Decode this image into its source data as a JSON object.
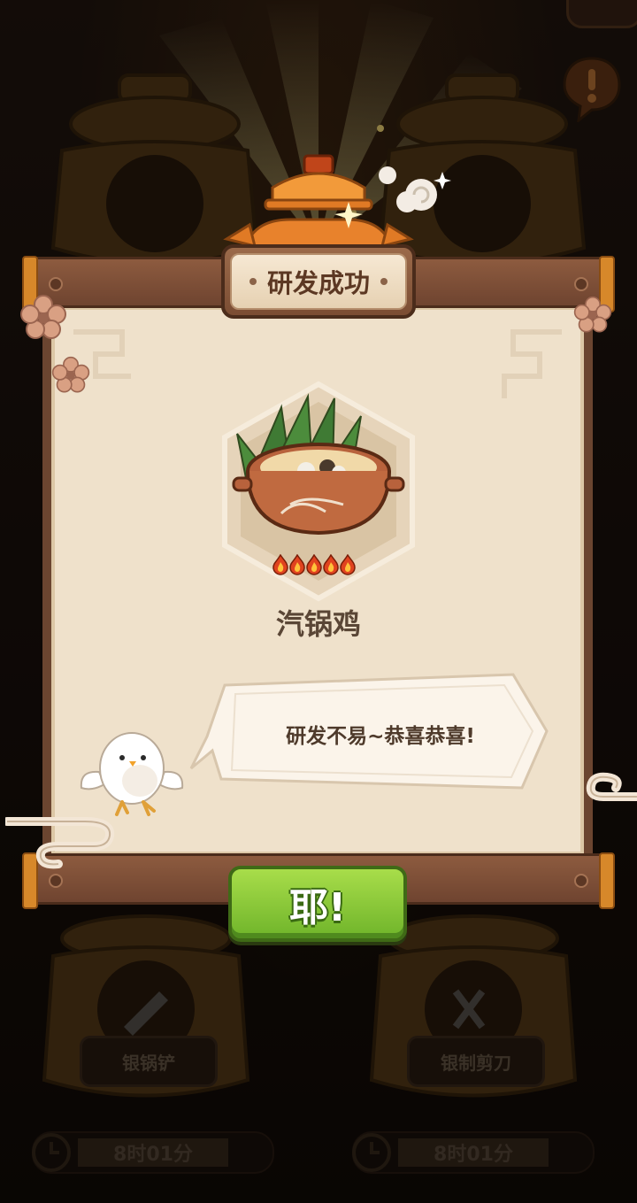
{
  "dialog": {
    "title": "研发成功",
    "dish_name": "汽锅鸡",
    "rating_flames": 5,
    "speech": "研发不易~恭喜恭喜!",
    "confirm_label": "耶!"
  },
  "background": {
    "stations": [
      {
        "label": "银锅铲",
        "timer": "8时01分"
      },
      {
        "label": "银制剪刀",
        "timer": "8时01分"
      }
    ]
  },
  "colors": {
    "panel": "#efe1cb",
    "wood": "#6b4530",
    "button_green": "#7fc534",
    "title_text": "#5c3823",
    "accent_orange": "#e07a25"
  }
}
